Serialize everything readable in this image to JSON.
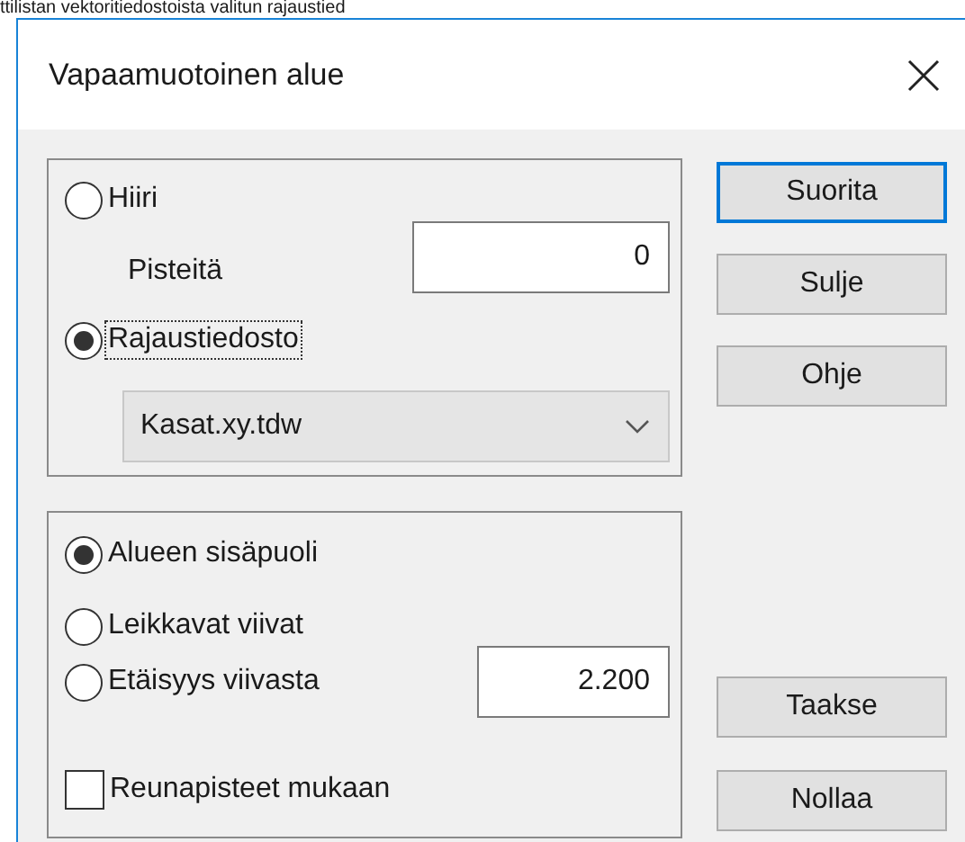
{
  "background_text": "ttilistan vektoritiedostoista valitun rajaustied",
  "dialog": {
    "title": "Vapaamuotoinen alue"
  },
  "source_group": {
    "options": [
      {
        "label": "Hiiri",
        "selected": false,
        "focused": false
      },
      {
        "label": "Rajaustiedosto",
        "selected": true,
        "focused": true
      }
    ],
    "points": {
      "label": "Pisteitä",
      "value": "0"
    },
    "file_dropdown": {
      "value": "Kasat.xy.tdw"
    }
  },
  "area_group": {
    "options": [
      {
        "label": "Alueen sisäpuoli",
        "selected": true
      },
      {
        "label": "Leikkavat viivat",
        "selected": false
      },
      {
        "label": "Etäisyys viivasta",
        "selected": false
      }
    ],
    "distance": {
      "value": "2.200"
    },
    "include_edge_points": {
      "label": "Reunapisteet mukaan",
      "checked": false
    }
  },
  "buttons_top": [
    {
      "label": "Suorita",
      "default": true
    },
    {
      "label": "Sulje",
      "default": false
    },
    {
      "label": "Ohje",
      "default": false
    }
  ],
  "buttons_bottom": [
    {
      "label": "Taakse",
      "default": false
    },
    {
      "label": "Nollaa",
      "default": false
    }
  ]
}
